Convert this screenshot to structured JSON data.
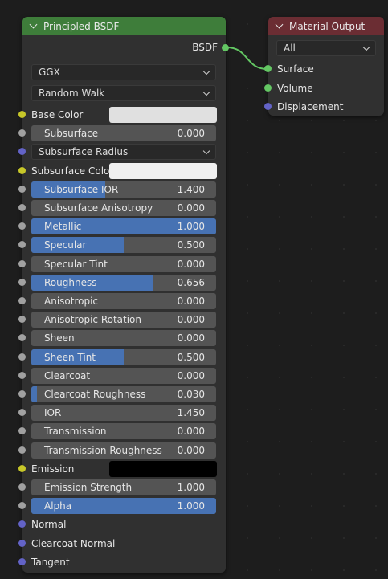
{
  "bsdf_node": {
    "title": "Principled BSDF",
    "output_label": "BSDF",
    "distribution": "GGX",
    "subsurface_method": "Random Walk",
    "inputs": [
      {
        "kind": "color",
        "label": "Base Color",
        "color": "#e0e0e0",
        "socket": "yellow"
      },
      {
        "kind": "slider",
        "label": "Subsurface",
        "value": "0.000",
        "fill": 0,
        "socket": "gray"
      },
      {
        "kind": "dropdown",
        "label": "Subsurface Radius",
        "socket": "purple"
      },
      {
        "kind": "color",
        "label": "Subsurface Colo",
        "color": "#f0f0f0",
        "socket": "yellow"
      },
      {
        "kind": "slider",
        "label": "Subsurface IOR",
        "value": "1.400",
        "fill": 0.4,
        "socket": "gray"
      },
      {
        "kind": "slider",
        "label": "Subsurface Anisotropy",
        "value": "0.000",
        "fill": 0,
        "socket": "gray"
      },
      {
        "kind": "slider",
        "label": "Metallic",
        "value": "1.000",
        "fill": 1,
        "socket": "gray"
      },
      {
        "kind": "slider",
        "label": "Specular",
        "value": "0.500",
        "fill": 0.5,
        "socket": "gray"
      },
      {
        "kind": "slider",
        "label": "Specular Tint",
        "value": "0.000",
        "fill": 0,
        "socket": "gray"
      },
      {
        "kind": "slider",
        "label": "Roughness",
        "value": "0.656",
        "fill": 0.656,
        "socket": "gray"
      },
      {
        "kind": "slider",
        "label": "Anisotropic",
        "value": "0.000",
        "fill": 0,
        "socket": "gray"
      },
      {
        "kind": "slider",
        "label": "Anisotropic Rotation",
        "value": "0.000",
        "fill": 0,
        "socket": "gray"
      },
      {
        "kind": "slider",
        "label": "Sheen",
        "value": "0.000",
        "fill": 0,
        "socket": "gray"
      },
      {
        "kind": "slider",
        "label": "Sheen Tint",
        "value": "0.500",
        "fill": 0.5,
        "socket": "gray"
      },
      {
        "kind": "slider",
        "label": "Clearcoat",
        "value": "0.000",
        "fill": 0,
        "socket": "gray"
      },
      {
        "kind": "slider",
        "label": "Clearcoat Roughness",
        "value": "0.030",
        "fill": 0.03,
        "socket": "gray"
      },
      {
        "kind": "slider",
        "label": "IOR",
        "value": "1.450",
        "fill": 0,
        "socket": "gray"
      },
      {
        "kind": "slider",
        "label": "Transmission",
        "value": "0.000",
        "fill": 0,
        "socket": "gray"
      },
      {
        "kind": "slider",
        "label": "Transmission Roughness",
        "value": "0.000",
        "fill": 0,
        "socket": "gray"
      },
      {
        "kind": "color",
        "label": "Emission",
        "color": "#000000",
        "socket": "yellow"
      },
      {
        "kind": "slider",
        "label": "Emission Strength",
        "value": "1.000",
        "fill": 0,
        "socket": "gray"
      },
      {
        "kind": "slider",
        "label": "Alpha",
        "value": "1.000",
        "fill": 1,
        "socket": "gray"
      },
      {
        "kind": "plain",
        "label": "Normal",
        "socket": "purple"
      },
      {
        "kind": "plain",
        "label": "Clearcoat Normal",
        "socket": "purple"
      },
      {
        "kind": "plain",
        "label": "Tangent",
        "socket": "purple"
      }
    ]
  },
  "output_node": {
    "title": "Material Output",
    "target": "All",
    "inputs": [
      {
        "label": "Surface",
        "socket": "green"
      },
      {
        "label": "Volume",
        "socket": "green"
      },
      {
        "label": "Displacement",
        "socket": "purple"
      }
    ]
  },
  "colors": {
    "socket_yellow": "#c7c729",
    "socket_gray": "#a1a1a1",
    "socket_purple": "#6363c7",
    "socket_green": "#63c763",
    "slider_fill": "#4772b3",
    "bsdf_header": "#3e7d3a",
    "output_header": "#6b2d33"
  }
}
